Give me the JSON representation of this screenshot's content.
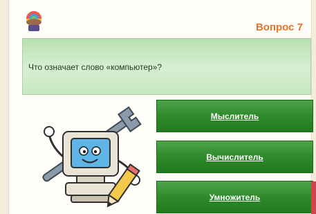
{
  "header": {
    "question_number": "Вопрос 7",
    "logo_icon": "rainbow-globe-logo-icon"
  },
  "question": {
    "text": "Что означает слово «компьютер»?"
  },
  "answers": [
    {
      "label": "Мыслитель"
    },
    {
      "label": "Вычислитель"
    },
    {
      "label": "Умножитель"
    }
  ],
  "illustration": {
    "icon": "cartoon-computer-with-wrench-and-pencil-icon"
  },
  "colors": {
    "accent_orange": "#e8742a",
    "button_green": "#2f8a2b",
    "question_bg": "#c7e7c1"
  }
}
